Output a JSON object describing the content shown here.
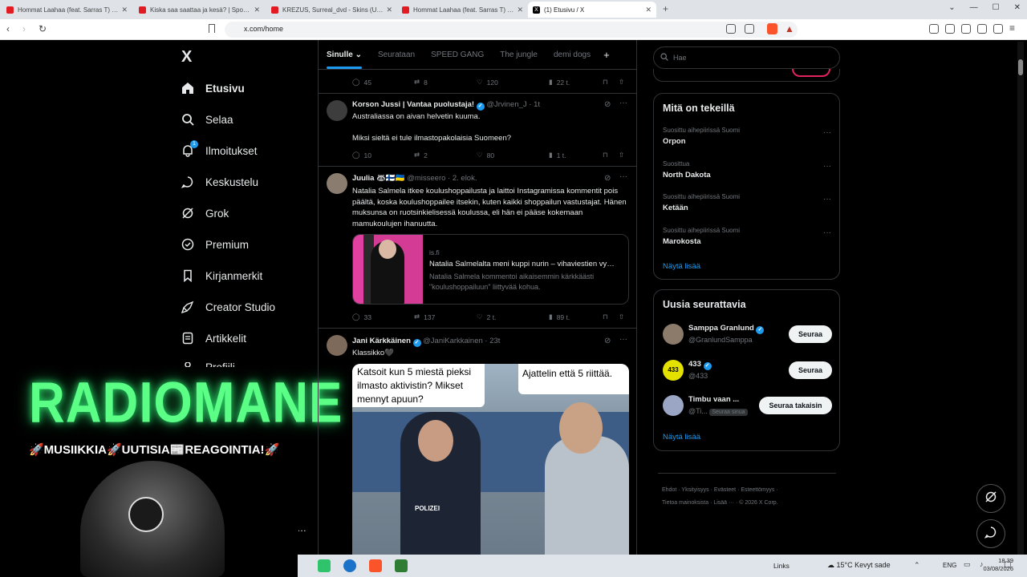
{
  "browser": {
    "tabs": [
      {
        "title": "Hommat Laahaa (feat. Sarras T) - You",
        "active": false
      },
      {
        "title": "Kiska saa saattaa ja kesä? | Sporttikatsomo",
        "active": false
      },
      {
        "title": "KREZUS, Surreal_dvd - Skins (Ultra Sl",
        "active": false
      },
      {
        "title": "Hommat Laahaa (feat. Sarras T) - You",
        "active": false
      },
      {
        "title": "(1) Etusivu / X",
        "active": true
      }
    ],
    "new_tab": "+",
    "url": "x.com/home"
  },
  "sidebar": {
    "logo": "X",
    "items": [
      {
        "label": "Etusivu",
        "icon": "home-icon"
      },
      {
        "label": "Selaa",
        "icon": "search-icon"
      },
      {
        "label": "Ilmoitukset",
        "icon": "bell-icon",
        "badge": "1"
      },
      {
        "label": "Keskustelu",
        "icon": "chat-icon"
      },
      {
        "label": "Grok",
        "icon": "grok-icon"
      },
      {
        "label": "Premium",
        "icon": "premium-icon"
      },
      {
        "label": "Kirjanmerkit",
        "icon": "bookmark-icon"
      },
      {
        "label": "Creator Studio",
        "icon": "rocket-icon"
      },
      {
        "label": "Artikkelit",
        "icon": "article-icon"
      },
      {
        "label": "Profiili",
        "icon": "profile-icon"
      }
    ],
    "more": "…"
  },
  "timeline": {
    "tabs": [
      "Sinulle",
      "Seurataan",
      "SPEED GANG",
      "The jungle",
      "demi dogs"
    ],
    "add_tab": "+",
    "top_actions": {
      "replies": "45",
      "reposts": "8",
      "likes": "120",
      "views": "22 t."
    },
    "tweets": [
      {
        "name": "Korson Jussi | Vantaa puolustaja!",
        "handle": "@Jrvinen_J · 1t",
        "lines": [
          "Australiassa on aivan helvetin kuuma.",
          "",
          "Miksi sieltä ei tule ilmastopakolaisia Suomeen?"
        ],
        "replies": "10",
        "reposts": "2",
        "likes": "80",
        "views": "1 t."
      },
      {
        "name": "Juulia 🦝🇫🇮🇺🇦",
        "handle": "@misseero · 2. elok.",
        "lines": [
          "Natalia Salmela itkee koulushoppailusta ja laittoi Instagramissa kommentit pois päältä, koska koulushoppailee itsekin, kuten kaikki shoppailun vastustajat. Hänen muksunsa on ruotsinkielisessä koulussa, eli hän ei pääse kokemaan mamukoulujen ihanuutta."
        ],
        "card": {
          "domain": "is.fi",
          "title": "Natalia Salmelalta meni kuppi nurin – vihaviestien vy…",
          "desc": "Natalia Salmela kommentoi aikaisemmin kärkkäästi \"koulushoppailuun\" liittyvää kohua."
        },
        "replies": "33",
        "reposts": "137",
        "likes": "2 t.",
        "views": "89 t."
      },
      {
        "name": "Jani Kärkkäinen",
        "handle": "@JaniKarkkainen · 23t",
        "lines": [
          "Klassikko🖤"
        ],
        "meme": {
          "left": "Katsoit kun 5 miestä pieksi ilmasto aktivistin? Mikset mennyt apuun?",
          "right": "Ajattelin että 5 riittää.",
          "police": "POLIZEI"
        }
      }
    ]
  },
  "right": {
    "search_placeholder": "Hae",
    "trends_title": "Mitä on tekeillä",
    "trends": [
      {
        "meta": "Suosittu aihepiirissä Suomi",
        "name": "Orpon"
      },
      {
        "meta": "Suosittua",
        "name": "North Dakota"
      },
      {
        "meta": "Suosittu aihepiirissä Suomi",
        "name": "Ketään"
      },
      {
        "meta": "Suosittu aihepiirissä Suomi",
        "name": "Marokosta"
      }
    ],
    "trends_more": "Näytä lisää",
    "follow_title": "Uusia seurattavia",
    "follows": [
      {
        "name": "Samppa Granlund",
        "handle": "@GranlundSamppa",
        "button": "Seuraa"
      },
      {
        "name": "433",
        "handle": "@433",
        "button": "Seuraa"
      },
      {
        "name": "Timbu vaan ...",
        "handle": "@Ti...",
        "tag": "Seuraa sinua",
        "button": "Seuraa takaisin"
      }
    ],
    "follow_more": "Näytä lisää",
    "footer": [
      "Ehdot",
      "Yksityisyys",
      "Evästeet",
      "Esteettömyys",
      "Tietoa mainoksista",
      "Lisää ···",
      "© 2026 X Corp."
    ]
  },
  "overlay": {
    "title": "RADIOMANE",
    "subtitle": "🚀MUSIIKKIA🚀UUTISIA📰REAGOINTIA!🚀"
  },
  "taskbar": {
    "links": "Links",
    "weather": "15°C  Kevyt sade",
    "lang": "ENG",
    "time": "18.39",
    "date": "03/08/2026"
  },
  "colors": {
    "accent": "#1d9bf0",
    "overlay_green": "#5cff86",
    "border": "#2f3336"
  }
}
